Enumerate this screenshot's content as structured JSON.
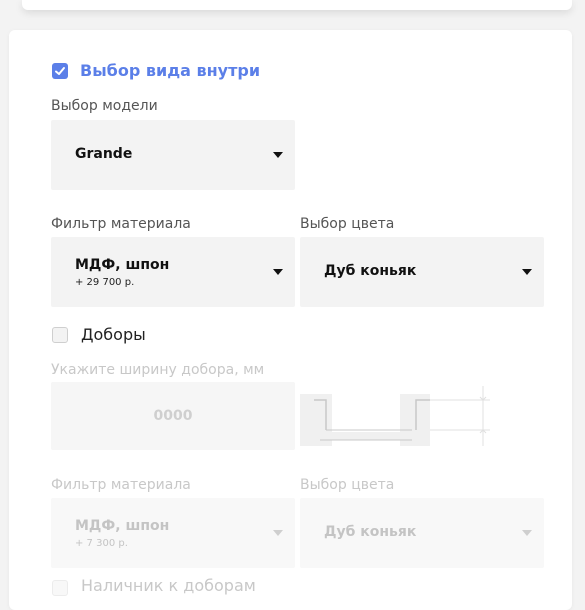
{
  "view_section": {
    "checkbox_checked": true,
    "title": "Выбор вида внутри",
    "model_label": "Выбор модели",
    "model_value": "Grande",
    "material_label": "Фильтр материала",
    "material_value": "МДФ, шпон",
    "material_price": "+ 29 700 р.",
    "color_label": "Выбор цвета",
    "color_value": "Дуб коньяк"
  },
  "extensions": {
    "checkbox_checked": false,
    "label": "Доборы",
    "width_label": "Укажите ширину добора, мм",
    "width_placeholder": "0000",
    "material_label": "Фильтр материала",
    "material_value": "МДФ, шпон",
    "material_price": "+ 7 300 р.",
    "color_label": "Выбор цвета",
    "color_value": "Дуб коньяк"
  },
  "casing": {
    "checkbox_checked": false,
    "label": "Наличник к доборам"
  },
  "colors": {
    "accent": "#5b7fe8",
    "field_bg": "#f3f3f3",
    "disabled_text": "#c8c8c8"
  }
}
